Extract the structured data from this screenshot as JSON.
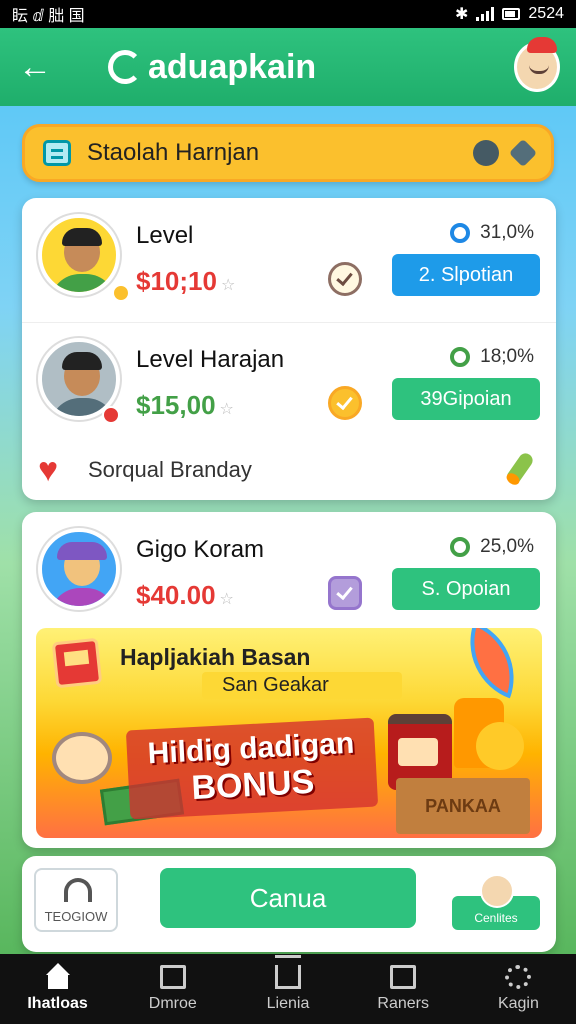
{
  "status_bar": {
    "left_text": "眃 ⅆ 朏 国",
    "time": "2524"
  },
  "header": {
    "brand": "aduapkain"
  },
  "banner_top": {
    "title": "Staolah Harnjan"
  },
  "offers": [
    {
      "name": "Level",
      "price": "$10;10",
      "percent": "31,0%",
      "button": "2. Slpotian"
    },
    {
      "name": "Level Harajan",
      "price": "$15,00",
      "percent": "18;0%",
      "button": "39Gipoian"
    }
  ],
  "favorite_row": {
    "label": "Sorqual Branday"
  },
  "offer3": {
    "name": "Gigo Koram",
    "price": "$40.00",
    "percent": "25,0%",
    "button": "S. Opoian"
  },
  "promo": {
    "heading": "Hapljakiah Basan",
    "subheading": "San Geakar",
    "bonus_line1": "Hildig dadigan",
    "bonus_line2": "BONUS",
    "box_label": "PANKAA"
  },
  "bottom_actions": {
    "login_label": "TEOGIOW",
    "cta_label": "Canua",
    "side_label": "Cenlites"
  },
  "tabs": [
    {
      "label": "Ihatloas",
      "icon": "home-icon"
    },
    {
      "label": "Dmroe",
      "icon": "document-icon"
    },
    {
      "label": "Lienia",
      "icon": "house-outline-icon"
    },
    {
      "label": "Raners",
      "icon": "checklist-icon"
    },
    {
      "label": "Kagin",
      "icon": "refresh-icon"
    }
  ],
  "colors": {
    "primary": "#2ec27e",
    "accent_blue": "#1e9be9",
    "banner": "#fbc02d",
    "price_red": "#e53935",
    "price_green": "#43a047"
  }
}
